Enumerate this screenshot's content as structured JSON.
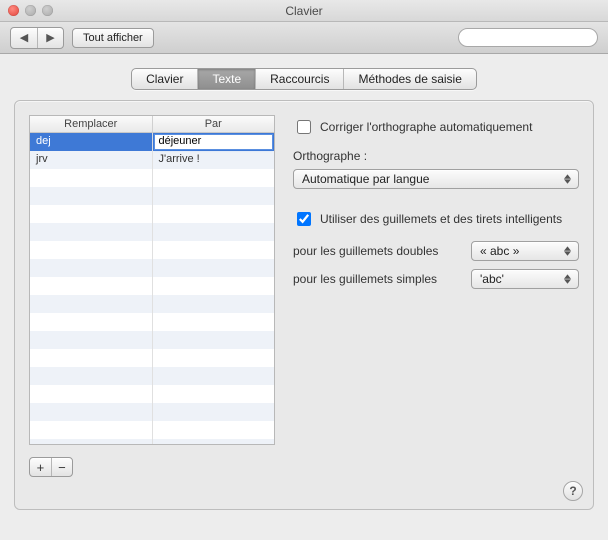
{
  "window": {
    "title": "Clavier"
  },
  "toolbar": {
    "back": "◀",
    "forward": "▶",
    "show_all": "Tout afficher",
    "search_placeholder": ""
  },
  "tabs": [
    {
      "label": "Clavier",
      "active": false
    },
    {
      "label": "Texte",
      "active": true
    },
    {
      "label": "Raccourcis",
      "active": false
    },
    {
      "label": "Méthodes de saisie",
      "active": false
    }
  ],
  "substitutions": {
    "header_replace": "Remplacer",
    "header_with": "Par",
    "rows": [
      {
        "key": "dej",
        "value": "déjeuner",
        "selected": true,
        "editing": true
      },
      {
        "key": "jrv",
        "value": "J'arrive !",
        "selected": false,
        "editing": false
      }
    ],
    "add_label": "+",
    "remove_label": "−"
  },
  "options": {
    "correct_spelling_auto": {
      "label": "Corriger l'orthographe automatiquement",
      "checked": false
    },
    "spelling_heading": "Orthographe :",
    "spelling_popup": "Automatique par langue",
    "smart_quotes": {
      "label": "Utiliser des guillemets et des tirets intelligents",
      "checked": true
    },
    "double_quotes_label": "pour les guillemets doubles",
    "double_quotes_value": "« abc »",
    "single_quotes_label": "pour les guillemets simples",
    "single_quotes_value": "'abc'"
  },
  "help_label": "?"
}
